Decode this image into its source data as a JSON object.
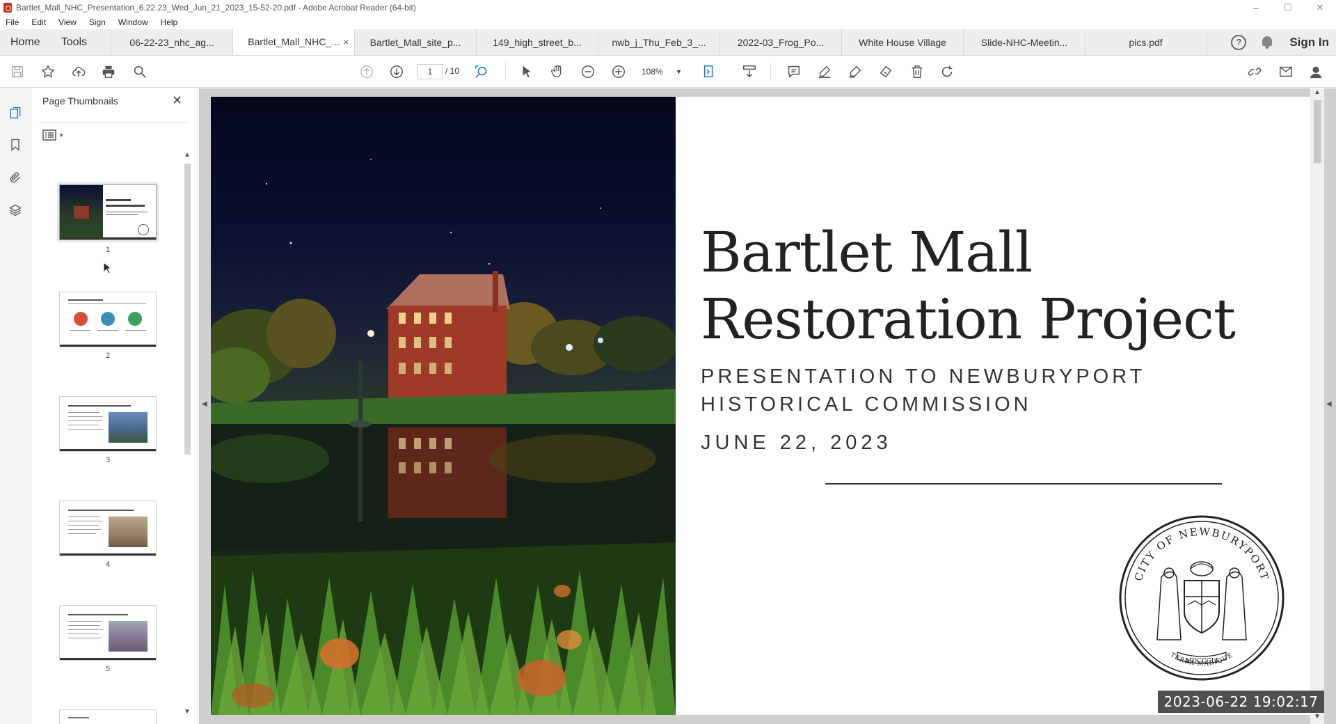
{
  "window": {
    "title": "Bartlet_Mall_NHC_Presentation_6.22.23_Wed_Jun_21_2023_15-52-20.pdf - Adobe Acrobat Reader (64-bit)",
    "controls": [
      "–",
      "☐",
      "✕"
    ]
  },
  "menu": [
    "File",
    "Edit",
    "View",
    "Sign",
    "Window",
    "Help"
  ],
  "tabs": {
    "home": "Home",
    "tools": "Tools",
    "documents": [
      {
        "label": "06-22-23_nhc_ag...",
        "active": false
      },
      {
        "label": "Bartlet_Mall_NHC_...",
        "active": true
      },
      {
        "label": "Bartlet_Mall_site_p...",
        "active": false
      },
      {
        "label": "149_high_street_b...",
        "active": false
      },
      {
        "label": "nwb_j_Thu_Feb_3_...",
        "active": false
      },
      {
        "label": "2022-03_Frog_Po...",
        "active": false
      },
      {
        "label": "White House Village",
        "active": false
      },
      {
        "label": "Slide-NHC-Meetin...",
        "active": false
      },
      {
        "label": "pics.pdf",
        "active": false
      }
    ],
    "close_label": "×",
    "help_label": "?",
    "sign_in": "Sign In"
  },
  "toolbar": {
    "current_page": "1",
    "page_total": "/ 10",
    "zoom": "108%"
  },
  "thumbnails_panel": {
    "title": "Page Thumbnails",
    "close": "✕",
    "pages": [
      {
        "number": "1",
        "selected": true
      },
      {
        "number": "2",
        "selected": false
      },
      {
        "number": "3",
        "selected": false
      },
      {
        "number": "4",
        "selected": false
      },
      {
        "number": "5",
        "selected": false
      }
    ]
  },
  "slide": {
    "title_line1": "Bartlet Mall",
    "title_line2": "Restoration Project",
    "subtitle_line1": "PRESENTATION TO NEWBURYPORT",
    "subtitle_line2": "HISTORICAL COMMISSION",
    "date": "JUNE 22, 2023",
    "seal_text": "CITY OF NEWBURYPORT",
    "seal_motto": "TERRA MARIQUE",
    "seal_year": "MDCCCLI"
  },
  "timestamp_overlay": "2023-06-22 19:02:17",
  "colors": {
    "acrobat_red": "#c8281e",
    "tab_bar": "#eeeeee",
    "doc_background": "#cfcfcf"
  }
}
